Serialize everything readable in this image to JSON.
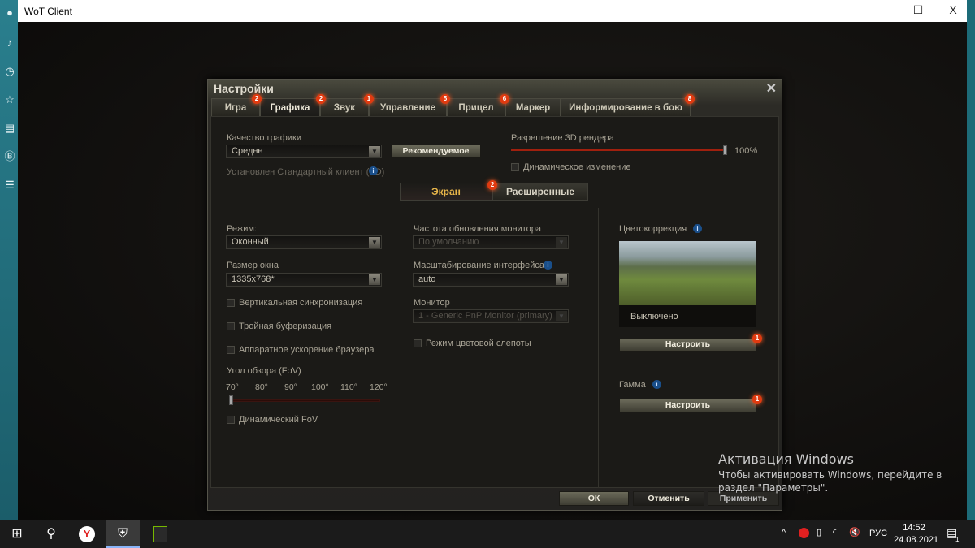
{
  "window": {
    "title": "WoT Client",
    "minimize": "–",
    "maximize": "☐",
    "close": "X"
  },
  "dialog": {
    "title": "Настройки",
    "close": "✕",
    "tabs": [
      {
        "label": "Игра",
        "badge": "2"
      },
      {
        "label": "Графика",
        "badge": "2",
        "active": true
      },
      {
        "label": "Звук",
        "badge": "1"
      },
      {
        "label": "Управление",
        "badge": "5"
      },
      {
        "label": "Прицел",
        "badge": "6"
      },
      {
        "label": "Маркер",
        "badge": ""
      },
      {
        "label": "Информирование в бою",
        "badge": "8"
      }
    ],
    "quality": {
      "label": "Качество графики",
      "value": "Средне",
      "recommended": "Рекомендуемое",
      "client_note": "Установлен Стандартный клиент (SD)"
    },
    "render": {
      "label": "Разрешение 3D рендера",
      "value_text": "100%",
      "value": 100,
      "dynamic": "Динамическое изменение",
      "dynamic_checked": false
    },
    "subtabs": [
      {
        "label": "Экран",
        "badge": "2",
        "active": true
      },
      {
        "label": "Расширенные"
      }
    ],
    "screen": {
      "mode_label": "Режим:",
      "mode_value": "Оконный",
      "size_label": "Размер окна",
      "size_value": "1335x768*",
      "vsync": "Вертикальная синхронизация",
      "triple": "Тройная буферизация",
      "hw_browser": "Аппаратное ускорение браузера",
      "fov_label": "Угол обзора (FoV)",
      "fov_ticks": [
        "70°",
        "80°",
        "90°",
        "100°",
        "110°",
        "120°"
      ],
      "fov_value": 70,
      "dynamic_fov": "Динамический FoV",
      "refresh_label": "Частота обновления монитора",
      "refresh_value": "По умолчанию",
      "scale_label": "Масштабирование интерфейса",
      "scale_value": "auto",
      "monitor_label": "Монитор",
      "monitor_value": "1 - Generic PnP Monitor (primary)",
      "colorblind": "Режим цветовой слепоты"
    },
    "color": {
      "label": "Цветокоррекция",
      "state": "Выключено",
      "button": "Настроить",
      "badge": "1"
    },
    "gamma": {
      "label": "Гамма",
      "button": "Настроить",
      "badge": "1"
    },
    "footer": {
      "ok": "ОК",
      "cancel": "Отменить",
      "apply": "Применить"
    }
  },
  "activation": {
    "title": "Активация Windows",
    "line1": "Чтобы активировать Windows, перейдите в",
    "line2": "раздел \"Параметры\"."
  },
  "taskbar": {
    "lang": "РУС",
    "time": "14:52",
    "date": "24.08.2021",
    "notif": "1"
  },
  "colors": {
    "accent": "#e03a10",
    "badge": "#e03a10",
    "info": "#1a4f8a"
  }
}
